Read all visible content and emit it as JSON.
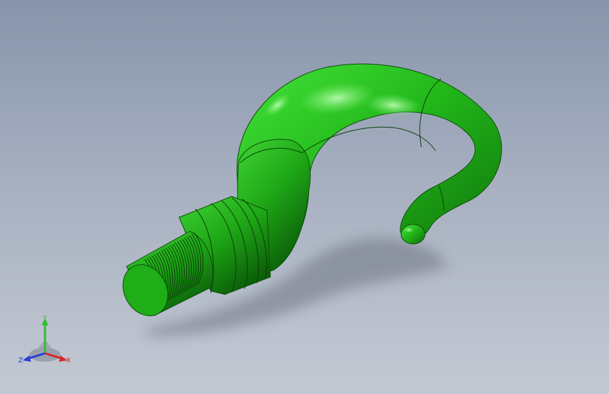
{
  "viewport": {
    "model_name": "hook",
    "model_color": "#22b81a",
    "background_top": "#8794aa",
    "background_bottom": "#c4c9d3"
  },
  "triad": {
    "x_label": "X",
    "y_label": "Y",
    "z_label": "Z",
    "x_color": "#d52a2a",
    "y_color": "#2fbf2f",
    "z_color": "#2a3fd5"
  }
}
